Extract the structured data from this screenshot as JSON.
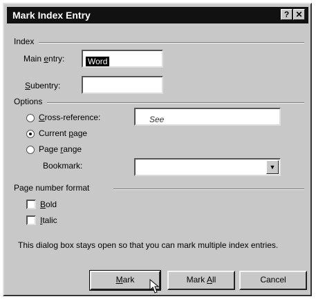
{
  "dialog": {
    "title": "Mark Index Entry",
    "help_glyph": "?",
    "close_glyph": "✕"
  },
  "index": {
    "heading": "Index",
    "main_entry_label_pre": "Main ",
    "main_entry_label_key": "e",
    "main_entry_label_post": "ntry:",
    "main_entry_value": "Word",
    "subentry_label_key": "S",
    "subentry_label_post": "ubentry:",
    "subentry_value": ""
  },
  "options": {
    "heading": "Options",
    "cross_reference_key": "C",
    "cross_reference_post": "ross-reference:",
    "cross_reference_value": "See",
    "current_page_pre": "Current ",
    "current_page_key": "p",
    "current_page_post": "age",
    "page_range_pre": "Page ",
    "page_range_key": "r",
    "page_range_post": "ange",
    "bookmark_label": "Bookmark:",
    "bookmark_value": "",
    "selected": "current_page"
  },
  "page_number_format": {
    "heading": "Page number format",
    "bold_key": "B",
    "bold_post": "old",
    "italic_key": "I",
    "italic_post": "talic",
    "bold_checked": false,
    "italic_checked": false
  },
  "note": "This dialog box stays open so that you can mark multiple index entries.",
  "buttons": {
    "mark_key": "M",
    "mark_post": "ark",
    "mark_all_pre": "Mark ",
    "mark_all_key": "A",
    "mark_all_post": "ll",
    "cancel": "Cancel"
  }
}
